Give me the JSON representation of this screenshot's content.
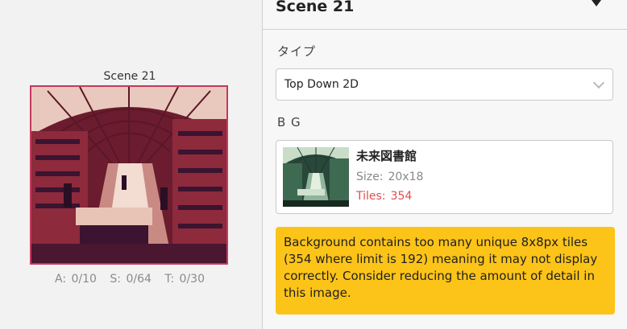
{
  "scene": {
    "title": "Scene 21",
    "stats": {
      "actors": "A: 0/10",
      "sprites": "S: 0/64",
      "triggers": "T: 0/30"
    }
  },
  "sidebar": {
    "title": "Scene 21",
    "type_label": "タイプ",
    "type_value": "Top Down 2D",
    "bg_label": "B G",
    "background": {
      "name": "未来図書館",
      "size_label": "Size:",
      "size_value": "20x18",
      "tiles_label": "Tiles:",
      "tiles_value": "354"
    },
    "warning": "Background contains too many unique 8x8px tiles (354 where limit is 192) meaning it may not display correctly. Consider reducing the amount of detail in this image."
  },
  "colors": {
    "accent_border": "#c4395f",
    "warning_bg": "#fcc419",
    "warning_text": "#e24d4d"
  },
  "icons": {
    "collapse": "triangle-down-icon",
    "select": "chevron-down-icon"
  }
}
